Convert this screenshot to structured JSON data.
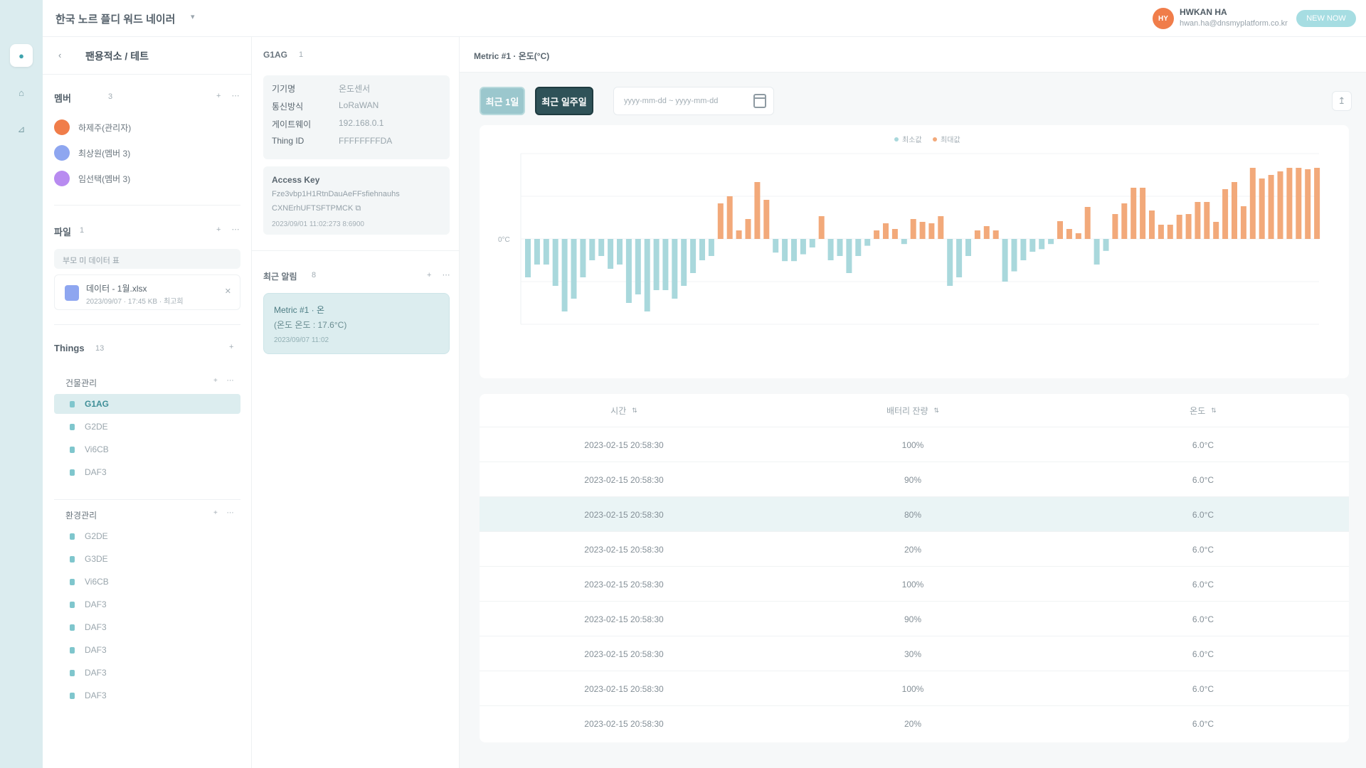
{
  "colors": {
    "accent": "#3fa3ad",
    "negative_bar": "#a9d8dc",
    "positive_bar": "#f2a97a",
    "avatar_orange": "#f07d4a",
    "avatar_blue": "#8ea6f0",
    "avatar_purple": "#b88bf0"
  },
  "rail": {
    "items": [
      {
        "icon": "home-icon"
      },
      {
        "icon": "user-icon"
      },
      {
        "icon": "chart-icon"
      }
    ]
  },
  "topbar": {
    "org_name": "한국 노르 플디 워드 네이러",
    "user_initials": "HY",
    "user_name": "HWKAN HA",
    "user_email": "hwan.ha@dnsmyplatform.co.kr",
    "pill_label": "NEW NOW"
  },
  "left_panel": {
    "title": "팬용적소 / 테트",
    "members": {
      "title": "멤버",
      "count": "3",
      "tools": "+ ⋯",
      "items": [
        {
          "name": "하제주(관리자)"
        },
        {
          "name": "최상원(멤버 3)"
        },
        {
          "name": "임선택(멤버 3)"
        }
      ]
    },
    "files": {
      "title": "파일",
      "count": "1",
      "tools": "+ ⋯",
      "tag": "부모 미 데이터 표",
      "item": {
        "name": "데이터 - 1월.xlsx",
        "meta": "2023/09/07 · 17:45 KB · 최고희",
        "delete": "✕"
      }
    },
    "things": {
      "title": "Things",
      "count": "13",
      "tools": "+",
      "groups": [
        {
          "name": "건물관리",
          "tools": "+ ⋯",
          "items": [
            "G1AG",
            "G2DE",
            "Vi6CB",
            "DAF3"
          ],
          "selected_index": 0
        },
        {
          "name": "환경관리",
          "tools": "+ ⋯",
          "items": [
            "G2DE",
            "G3DE",
            "Vi6CB",
            "DAF3",
            "DAF3",
            "DAF3",
            "DAF3",
            "DAF3"
          ]
        }
      ]
    }
  },
  "middle_panel": {
    "title": "G1AG",
    "title_count": "1",
    "info": [
      {
        "label": "기기명",
        "value": "온도센서"
      },
      {
        "label": "통신방식",
        "value": "LoRaWAN"
      },
      {
        "label": "게이트웨이",
        "value": "192.168.0.1"
      },
      {
        "label": "Thing ID",
        "value": "FFFFFFFFDA"
      }
    ],
    "access_key": {
      "title": "Access Key",
      "line1": "Fze3vbp1H1RtnDauAeFFsfiehnauhs",
      "line2": "CXNErhUFTSFTPMCK ⧉",
      "date": "2023/09/01 11:02:273 8:6900"
    },
    "events": {
      "title": "최근 알림",
      "count": "8",
      "tools": "+ ⋯",
      "card": {
        "title": "Metric #1 · 온",
        "desc": "(온도 온도 : 17.6°C)",
        "date": "2023/09/07 11:02"
      }
    }
  },
  "main": {
    "title": "Metric #1 · 온도(°C)",
    "buttons": {
      "filter_a": "최근 1일",
      "filter_b": "최근 일주일"
    },
    "date_range_placeholder": "yyyy-mm-dd ~ yyyy-mm-dd",
    "export_icon": "↥"
  },
  "chart_data": {
    "type": "bar",
    "legend": [
      "최소값",
      "최대값"
    ],
    "zero_label": "0°C",
    "ylim": [
      -100,
      120
    ],
    "values": [
      -45,
      -30,
      -30,
      -55,
      -85,
      -70,
      -45,
      -25,
      -20,
      -35,
      -30,
      -75,
      -65,
      -85,
      -60,
      -60,
      -70,
      -55,
      -40,
      -25,
      -20,
      50,
      60,
      12,
      28,
      80,
      55,
      -16,
      -26,
      -26,
      -18,
      -10,
      32,
      -25,
      -20,
      -40,
      -20,
      -8,
      12,
      22,
      14,
      -6,
      28,
      24,
      22,
      32,
      -55,
      -45,
      -20,
      12,
      18,
      12,
      -50,
      -38,
      -25,
      -15,
      -12,
      -6,
      25,
      14,
      8,
      45,
      -30,
      -14,
      35,
      50,
      72,
      72,
      40,
      20,
      20,
      34,
      35,
      52,
      52,
      24,
      70,
      80,
      46,
      100,
      85,
      90,
      95,
      100,
      100,
      98,
      100
    ]
  },
  "table": {
    "headers": [
      "시간",
      "배터리 잔량",
      "온도"
    ],
    "selected_index": 2,
    "rows": [
      [
        "2023-02-15 20:58:30",
        "100%",
        "6.0°C"
      ],
      [
        "2023-02-15 20:58:30",
        "90%",
        "6.0°C"
      ],
      [
        "2023-02-15 20:58:30",
        "80%",
        "6.0°C"
      ],
      [
        "2023-02-15 20:58:30",
        "20%",
        "6.0°C"
      ],
      [
        "2023-02-15 20:58:30",
        "100%",
        "6.0°C"
      ],
      [
        "2023-02-15 20:58:30",
        "90%",
        "6.0°C"
      ],
      [
        "2023-02-15 20:58:30",
        "30%",
        "6.0°C"
      ],
      [
        "2023-02-15 20:58:30",
        "100%",
        "6.0°C"
      ],
      [
        "2023-02-15 20:58:30",
        "20%",
        "6.0°C"
      ]
    ]
  }
}
